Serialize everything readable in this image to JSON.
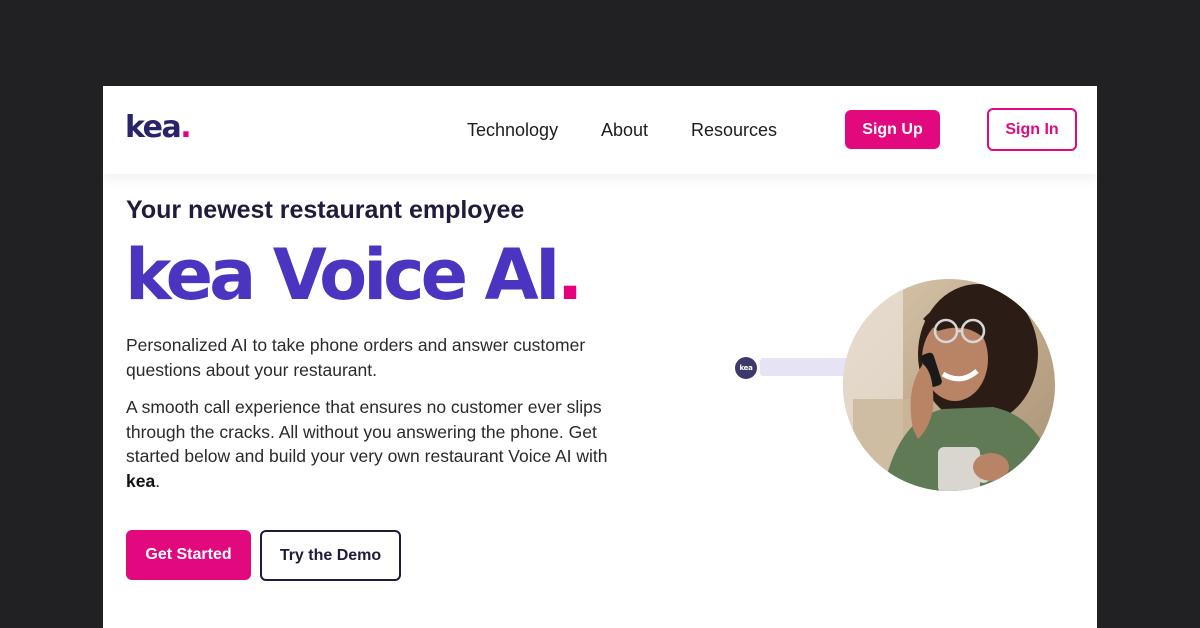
{
  "nav": {
    "logo_text": "kea",
    "logo_dot": ".",
    "links": [
      "Technology",
      "About",
      "Resources"
    ],
    "sign_up": "Sign Up",
    "sign_in": "Sign In"
  },
  "hero": {
    "subtitle": "Your newest restaurant employee",
    "title": "kea Voice AI",
    "title_dot": ".",
    "para1": "Personalized AI to take phone orders and answer customer questions about your restaurant.",
    "para2_prefix": "A smooth call experience that ensures no customer ever slips through the cracks. All without you answering the phone. Get started below and build your very own restaurant Voice AI with ",
    "para2_brand": "kea",
    "para2_suffix": ".",
    "cta_primary": "Get Started",
    "cta_secondary": "Try the Demo"
  },
  "illustration": {
    "chat_avatar_label": "kea"
  },
  "colors": {
    "brand_pink": "#e2097f",
    "brand_purple": "#4a34c0",
    "logo_navy": "#27246b",
    "dark_text": "#1e1b3c",
    "frame_bg": "#212124"
  },
  "icons": [
    "kea-logo",
    "chat-avatar-icon",
    "woman-on-phone-photo"
  ]
}
